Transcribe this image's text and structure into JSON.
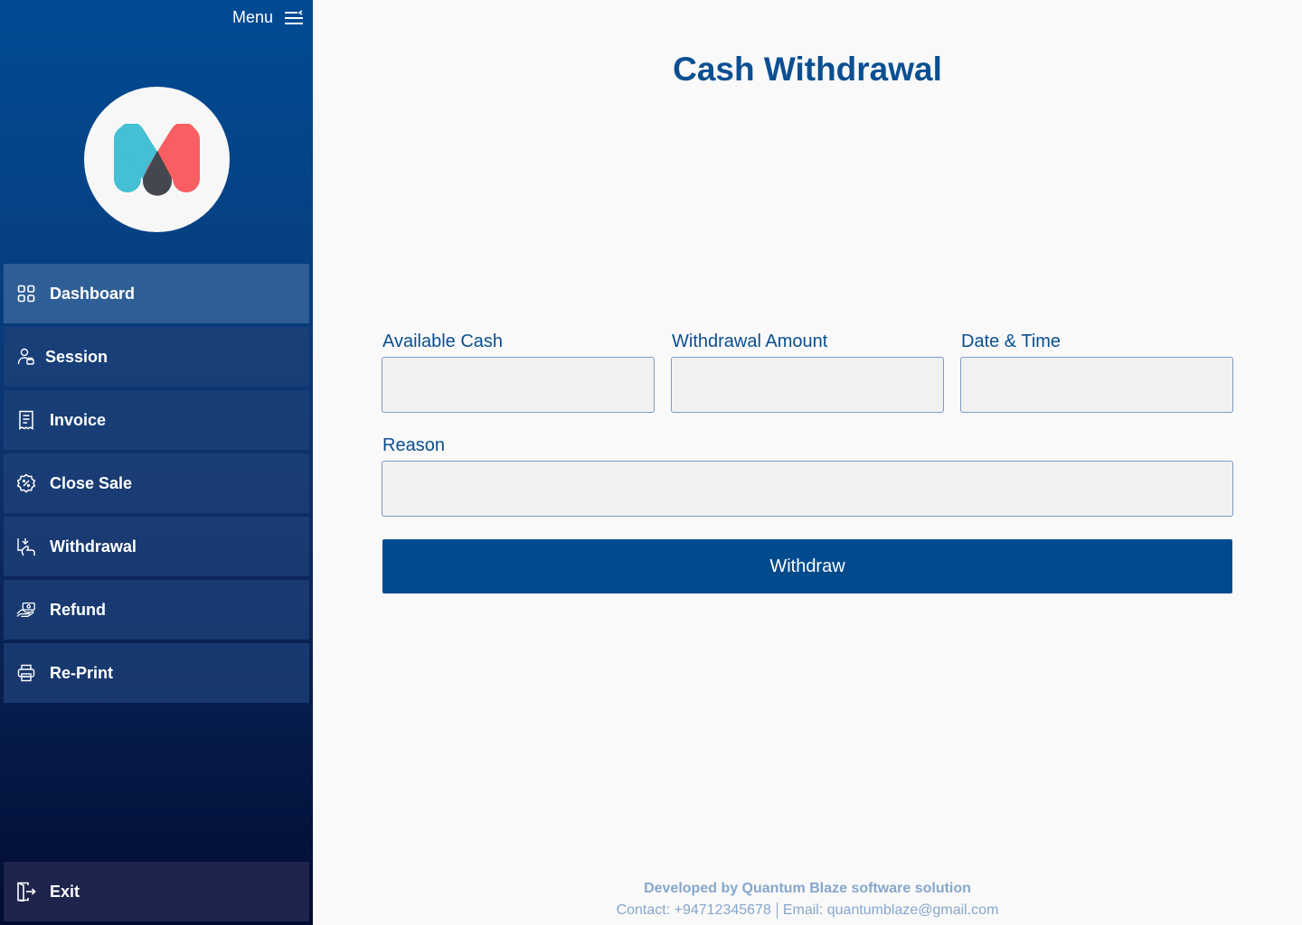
{
  "sidebar": {
    "menu_label": "Menu",
    "items": [
      {
        "label": "Dashboard",
        "icon": "grid-icon"
      },
      {
        "label": "Session",
        "icon": "user-session-icon"
      },
      {
        "label": "Invoice",
        "icon": "receipt-icon"
      },
      {
        "label": "Close Sale",
        "icon": "discount-badge-icon"
      },
      {
        "label": "Withdrawal",
        "icon": "cash-withdrawal-icon"
      },
      {
        "label": "Refund",
        "icon": "hand-money-icon"
      },
      {
        "label": "Re-Print",
        "icon": "printer-icon"
      }
    ],
    "active_item": "Dashboard",
    "exit_label": "Exit"
  },
  "main": {
    "title": "Cash Withdrawal",
    "form": {
      "available_cash_label": "Available Cash",
      "available_cash_value": "",
      "withdrawal_amount_label": "Withdrawal Amount",
      "withdrawal_amount_value": "",
      "date_time_label": "Date & Time",
      "date_time_value": "",
      "reason_label": "Reason",
      "reason_value": "",
      "submit_label": "Withdraw"
    }
  },
  "footer": {
    "developed_by": "Developed by Quantum Blaze software solution",
    "contact": "Contact: +94712345678",
    "email": "Email: quantumblaze@gmail.com"
  },
  "colors": {
    "primary": "#004b8d",
    "title": "#0a4f91",
    "sidebar_top": "#004b93",
    "sidebar_bottom": "#020c34",
    "footer_text": "#86a6cb",
    "logo_teal": "#45bfd3",
    "logo_coral": "#f95f62",
    "logo_dark": "#45474f"
  }
}
